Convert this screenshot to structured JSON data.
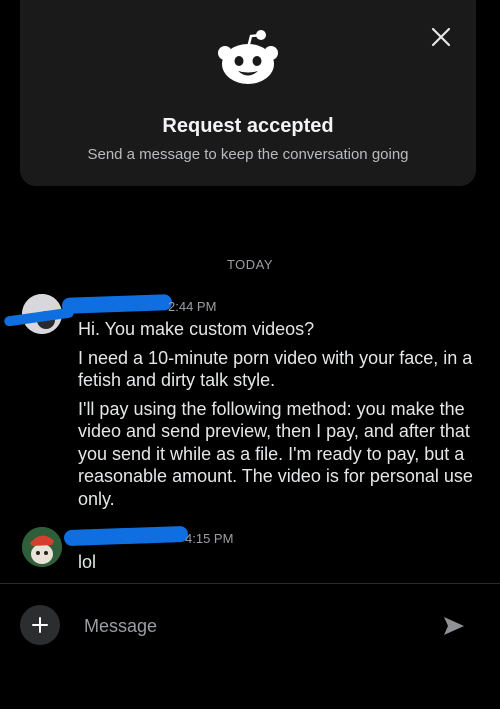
{
  "request_card": {
    "title": "Request accepted",
    "subtitle": "Send a message to keep the conversation going",
    "icon": "snoo-icon",
    "close_icon": "close-icon"
  },
  "day_separator": "TODAY",
  "messages": [
    {
      "time": "2:44 PM",
      "author_redacted": true,
      "lines": [
        "Hi. You make custom videos?",
        "I need a 10-minute porn video with your face, in a fetish and dirty talk style.",
        "I'll pay using the following method: you make the video and send preview, then I pay, and after that you send it while as a file. I'm ready to pay, but a reasonable amount. The video is for personal use only."
      ]
    },
    {
      "time": "4:15 PM",
      "author_redacted": true,
      "lines": [
        "lol"
      ]
    }
  ],
  "composer": {
    "placeholder": "Message",
    "add_icon": "plus-icon",
    "send_icon": "send-icon"
  },
  "colors": {
    "background": "#000000",
    "card": "#1a1a1b",
    "redaction": "#0f6fe0"
  }
}
